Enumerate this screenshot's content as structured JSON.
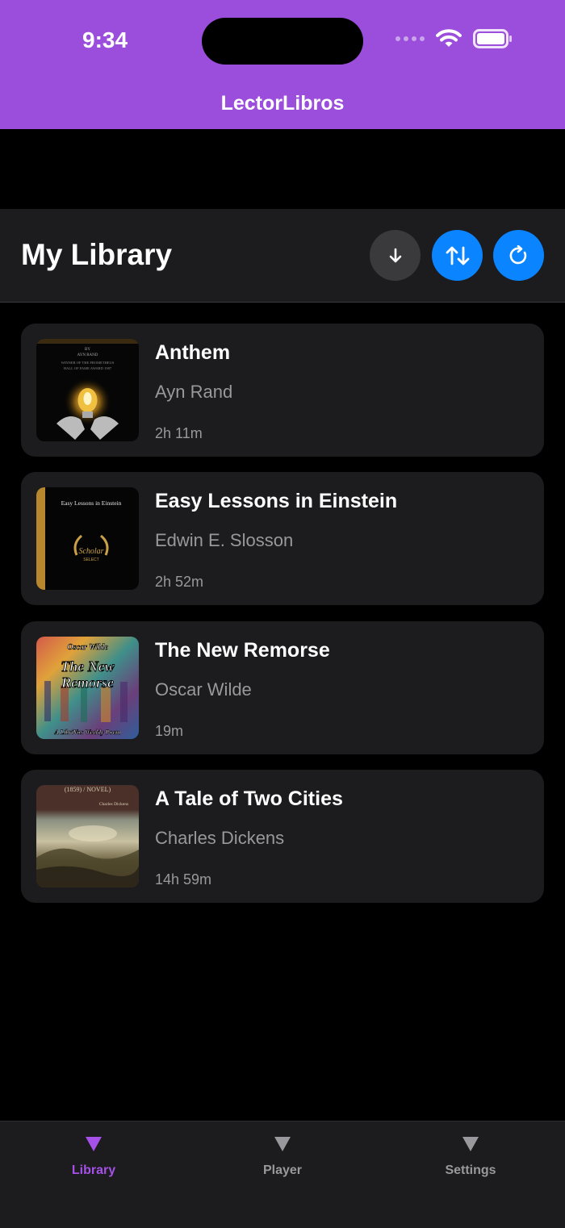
{
  "status_bar": {
    "time": "9:34"
  },
  "app": {
    "title": "LectorLibros"
  },
  "library": {
    "title": "My Library"
  },
  "colors": {
    "brand": "#9b4ddb",
    "accent_blue": "#0a84ff",
    "active_tab": "#a550e6"
  },
  "header_buttons": [
    {
      "icon": "arrow-down-icon"
    },
    {
      "icon": "sort-arrows-icon"
    },
    {
      "icon": "refresh-icon"
    }
  ],
  "books": [
    {
      "title": "Anthem",
      "author": "Ayn Rand",
      "duration": "2h 11m",
      "cover": {
        "line1": "BY",
        "line2": "AYN RAND",
        "line3": "WINNER OF THE PROMETHEUS",
        "line4": "HALL OF FAME AWARD 1987"
      }
    },
    {
      "title": "Easy Lessons in Einstein",
      "author": "Edwin E. Slosson",
      "duration": "2h 52m",
      "cover": {
        "line1": "Easy Lessons in Einstein",
        "line2": "Scholar",
        "line3": "SELECT"
      }
    },
    {
      "title": "The New Remorse",
      "author": "Oscar Wilde",
      "duration": "19m",
      "cover": {
        "line1": "Oscar Wilde",
        "line2": "The New",
        "line3": "Remorse",
        "line4": "A LibriVox Weekly Poem"
      }
    },
    {
      "title": "A Tale of Two Cities",
      "author": "Charles Dickens",
      "duration": "14h 59m",
      "cover": {
        "line1": "(1859) / NOVEL)",
        "line2": "Charles Dickens"
      }
    }
  ],
  "tabs": [
    {
      "label": "Library",
      "active": true
    },
    {
      "label": "Player",
      "active": false
    },
    {
      "label": "Settings",
      "active": false
    }
  ]
}
